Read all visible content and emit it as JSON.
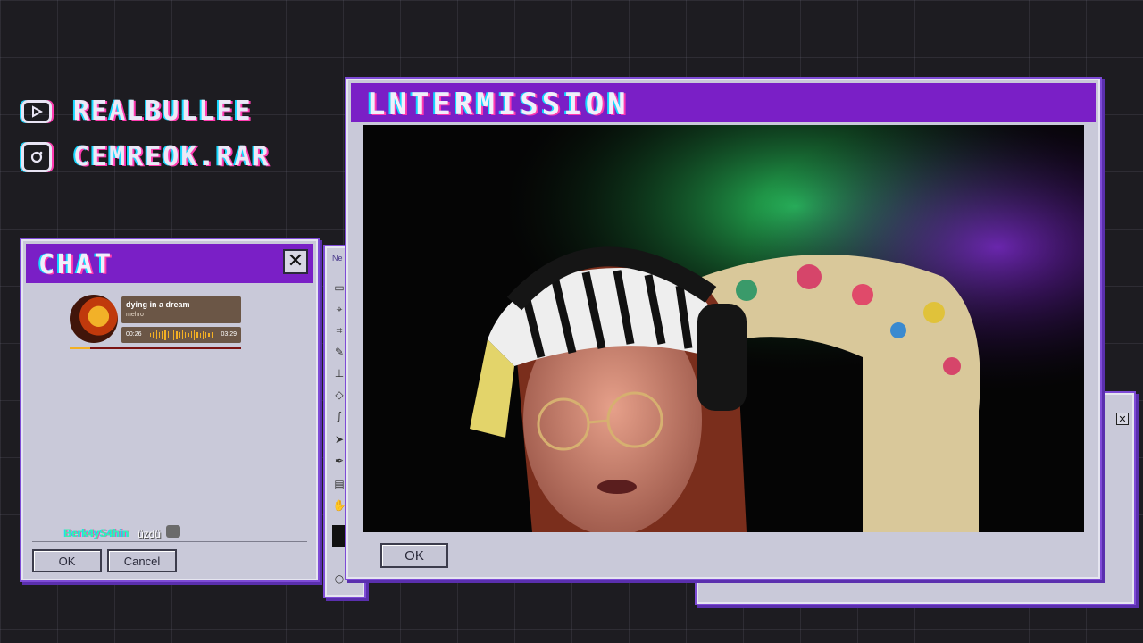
{
  "socials": [
    {
      "platform_icon": "youtube-icon",
      "handle": "REALBULLEE"
    },
    {
      "platform_icon": "instagram-icon",
      "handle": "CEMREOK.RAR"
    }
  ],
  "chat_window": {
    "title": "CHAT",
    "close_label": "✕",
    "now_playing": {
      "song": "dying in a dream",
      "artist": "mehro",
      "elapsed": "00:26",
      "duration": "03:29",
      "progress": 0.12
    },
    "messages": [
      {
        "user": "Berk4yS4hin",
        "text": "üzdü"
      }
    ],
    "ok_label": "OK",
    "cancel_label": "Cancel"
  },
  "toolbox_window": {
    "title": "Ne"
  },
  "main_window": {
    "title": "LNTERMISSION",
    "ok_label": "OK"
  },
  "colors": {
    "titlebar": "#7a1fc6",
    "window_bg": "#c9c9d9",
    "accent_cyan": "#16d8ff",
    "accent_pink": "#ff3bb0"
  }
}
